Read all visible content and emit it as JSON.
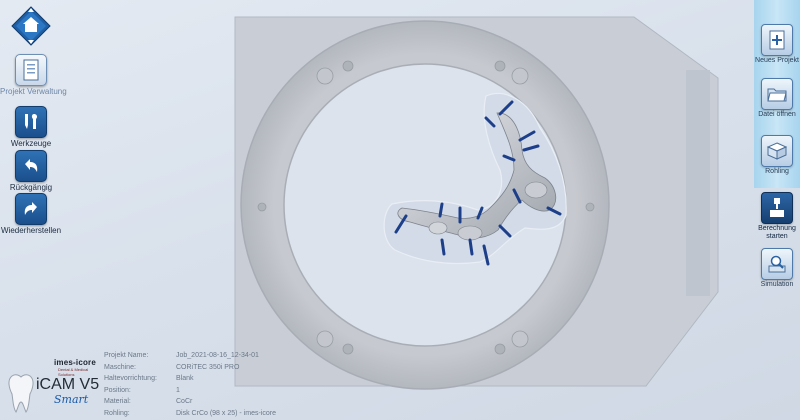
{
  "left_toolbar": {
    "home_icon": "home-icon",
    "items": [
      {
        "id": "project",
        "label": "Projekt Verwaltung",
        "icon": "project-document-icon"
      },
      {
        "id": "tools",
        "label": "Werkzeuge",
        "icon": "wrench-screwdriver-icon"
      },
      {
        "id": "undo",
        "label": "Rückgängig",
        "icon": "undo-arrow-icon"
      },
      {
        "id": "redo",
        "label": "Wiederherstellen",
        "icon": "redo-arrow-icon"
      }
    ]
  },
  "right_toolbar": {
    "items": [
      {
        "id": "new-project",
        "label": "Neues Projekt",
        "icon": "new-document-icon"
      },
      {
        "id": "open-file",
        "label": "Datei öffnen",
        "icon": "folder-icon"
      },
      {
        "id": "blank",
        "label": "Rohling",
        "icon": "blank-box-icon"
      },
      {
        "id": "calculate",
        "label": "Berechnung starten",
        "icon": "mill-tool-icon"
      },
      {
        "id": "simulation",
        "label": "Simulation",
        "icon": "simulation-magnifier-icon"
      }
    ]
  },
  "logo": {
    "brand": "imes-icore",
    "brand_sub": "Dental & Medical Solutions",
    "product": "iCAM V5",
    "edition": "Smart"
  },
  "info": [
    {
      "key": "Projekt Name:",
      "value": "Job_2021-08-16_12-34-01"
    },
    {
      "key": "Maschine:",
      "value": "CORiTEC 350i PRO"
    },
    {
      "key": "Haltevorrichtung:",
      "value": "Blank"
    },
    {
      "key": "Position:",
      "value": "1"
    },
    {
      "key": "Material:",
      "value": "CoCr"
    },
    {
      "key": "Rohling:",
      "value": "Disk CrCo (98 x 25) - imes-icore"
    }
  ],
  "colors": {
    "accent_blue": "#1b4f8c",
    "connector_blue": "#1d3f8a",
    "ring_gray": "#bcc0c7",
    "strip_cyan": "#b7ddf2"
  }
}
